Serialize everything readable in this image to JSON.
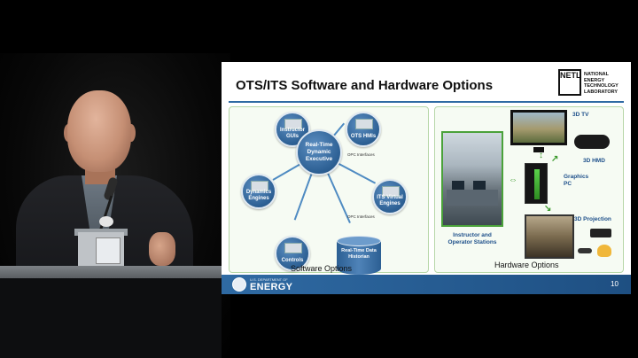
{
  "slide": {
    "title": "OTS/ITS Software and Hardware Options",
    "logo": {
      "letters": "NETL",
      "text_line1": "NATIONAL",
      "text_line2": "ENERGY",
      "text_line3": "TECHNOLOGY",
      "text_line4": "LABORATORY"
    },
    "software": {
      "center": "Real-Time Dynamic Executive",
      "nodes": [
        "Instructor GUIs",
        "OTS HMIs",
        "Dynamics Engines",
        "ITS Virtual Engines",
        "Controls"
      ],
      "historian": "Real-Time Data Historian",
      "opc_1": "OPC Interfaces",
      "opc_2": "OPC Interfaces",
      "caption": "Software Options"
    },
    "hardware": {
      "stations": "Instructor and Operator Stations",
      "tv": "3D TV",
      "hmd": "3D HMD",
      "graphics_pc": "Graphics PC",
      "projection": "3D Projection",
      "caption": "Hardware Options"
    },
    "footer": {
      "agency_small": "U.S. DEPARTMENT OF",
      "agency": "ENERGY",
      "page": "10"
    }
  },
  "colors": {
    "accent_blue": "#2f6aa3",
    "accent_green": "#3d9a2e",
    "label_blue": "#1d4f8a"
  }
}
